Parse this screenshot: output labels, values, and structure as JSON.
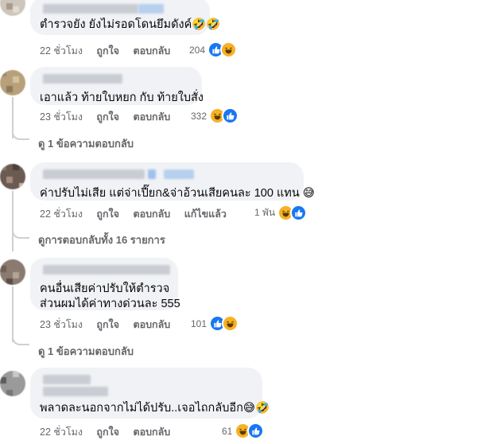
{
  "comments": [
    {
      "text": "ตำรวจยัง ยังไม่รอดโดนยึมดังค์🤣🤣",
      "time": "22 ชั่วโมง",
      "like_label": "ถูกใจ",
      "reply_label": "ตอบกลับ",
      "reaction_count": "204",
      "reaction_icons": [
        "like",
        "haha"
      ]
    },
    {
      "text": "เอาแล้ว ท้ายใบหยก กับ ท้ายใบสั่ง",
      "time": "23 ชั่วโมง",
      "like_label": "ถูกใจ",
      "reply_label": "ตอบกลับ",
      "reaction_count": "332",
      "reaction_icons": [
        "haha",
        "like"
      ],
      "replies_link": "ดู 1 ข้อความตอบกลับ"
    },
    {
      "text": "ค่าปรับไม่เสีย แต่จ่าเปี๊ยก&จ่าอ้วนเสียคนละ 100 แทน 😅",
      "time": "22 ชั่วโมง",
      "like_label": "ถูกใจ",
      "reply_label": "ตอบกลับ",
      "edited_label": "แก้ไขแล้ว",
      "reaction_count": "1 พัน",
      "reaction_icons": [
        "haha",
        "like"
      ],
      "replies_link": "ดูการตอบกลับทั้ง 16 รายการ"
    },
    {
      "text_line1": "คนอื่นเสียค่าปรับให้ตำรวจ",
      "text_line2": "ส่วนผมได้ค่าทางด่วนละ 555",
      "time": "23 ชั่วโมง",
      "like_label": "ถูกใจ",
      "reply_label": "ตอบกลับ",
      "reaction_count": "101",
      "reaction_icons": [
        "like",
        "haha"
      ],
      "replies_link": "ดู 1 ข้อความตอบกลับ"
    },
    {
      "text": "พลาดละนอกจากไม่ได้ปรับ..เจอไถกลับอีก😅🤣",
      "time": "22 ชั่วโมง",
      "like_label": "ถูกใจ",
      "reply_label": "ตอบกลับ",
      "reaction_count": "61",
      "reaction_icons": [
        "haha",
        "like"
      ]
    }
  ],
  "colors": {
    "bubble": "#f0f2f5",
    "meta_text": "#65676b",
    "like_blue": "#1877f2",
    "haha_yellow": "#f7b125",
    "thread_line": "#ced0d4"
  }
}
